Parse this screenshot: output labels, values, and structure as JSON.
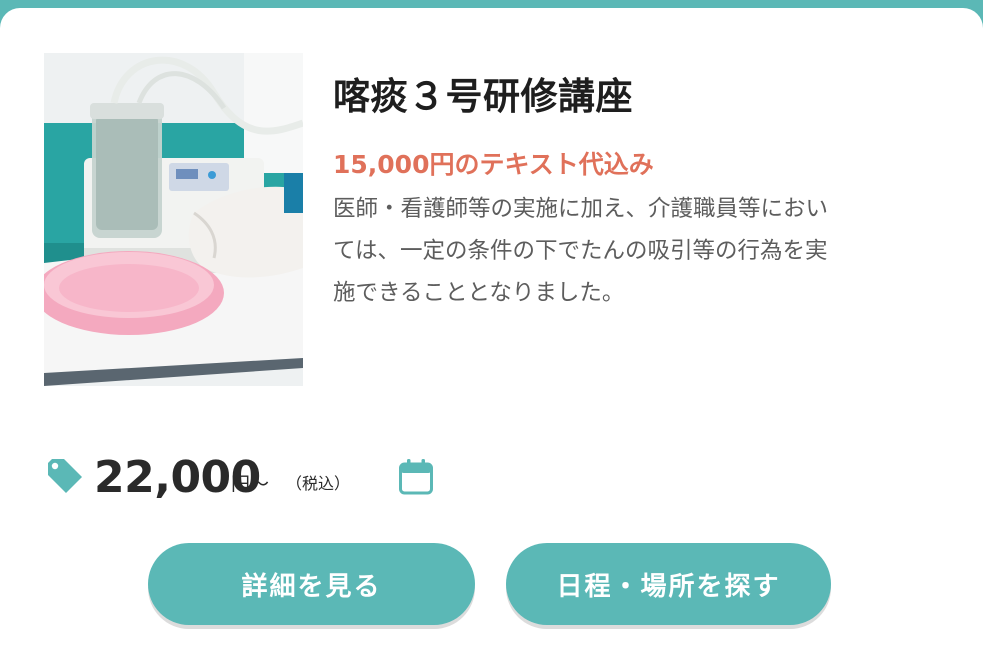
{
  "course": {
    "title": "喀痰３号研修講座",
    "subtitle": "15,000円のテキスト代込み",
    "description_lines": [
      "医師・看護師等の実施に加え、介護職員等におい",
      "ては、一定の条件の下でたんの吸引等の行為を実",
      "施できることとなりました。"
    ],
    "image_alt": "suction-device-photo"
  },
  "price": {
    "amount": "22,000",
    "suffix": "円～",
    "tax": "（税込）"
  },
  "buttons": {
    "details_label": "詳細を見る",
    "schedule_label": "日程・場所を探す"
  },
  "colors": {
    "accent": "#5bb8b6",
    "subtitle": "#e0715a",
    "text": "#5d5d5d"
  },
  "icons": {
    "price": "price-tag-icon",
    "schedule": "calendar-icon"
  }
}
